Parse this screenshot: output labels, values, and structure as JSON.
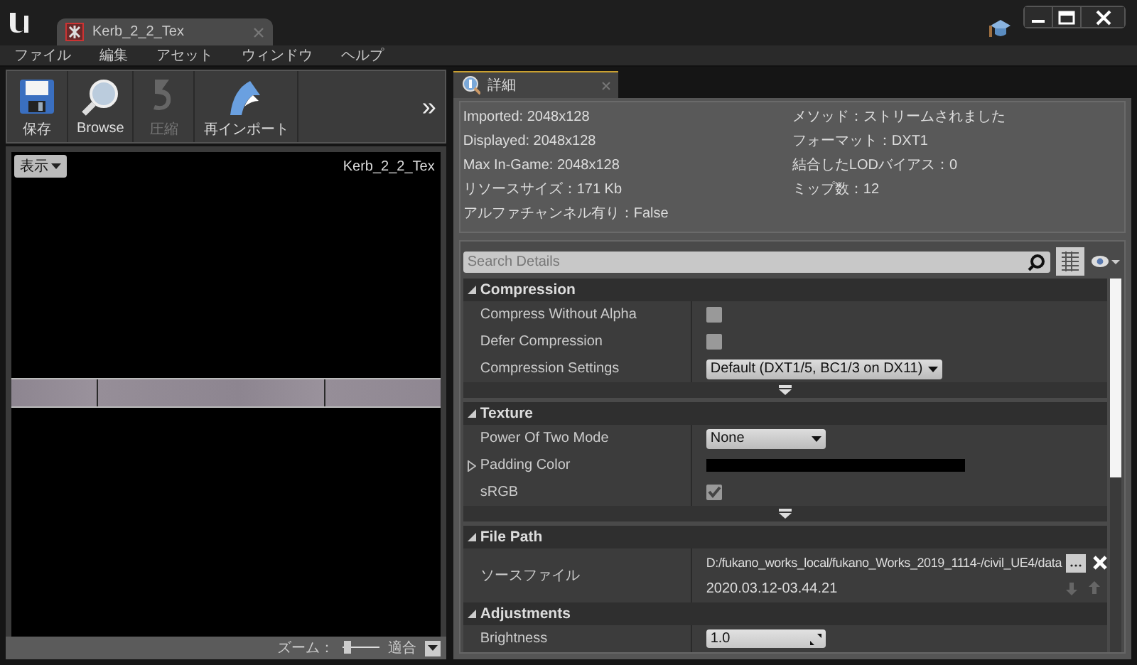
{
  "title_bar": {
    "tab": {
      "label": "Kerb_2_2_Tex",
      "selected": true
    }
  },
  "menu": [
    "ファイル",
    "編集",
    "アセット",
    "ウィンドウ",
    "ヘルプ"
  ],
  "toolbar": {
    "buttons": [
      {
        "label": "保存",
        "kind": "save",
        "disabled": false
      },
      {
        "label": "Browse",
        "kind": "browse",
        "disabled": false
      },
      {
        "label": "圧縮",
        "kind": "compress",
        "disabled": true
      },
      {
        "label": "再インポート",
        "kind": "reimport",
        "disabled": false
      }
    ],
    "overflow": "»"
  },
  "viewport": {
    "view_button": "表示",
    "asset_name": "Kerb_2_2_Tex",
    "zoom_label": "ズーム：",
    "zoom": {
      "level": 0.15
    },
    "zoom_mode": "適合"
  },
  "details": {
    "tab": {
      "label": "詳細",
      "selected": true
    },
    "info": {
      "left": [
        "Imported: 2048x128",
        "Displayed: 2048x128",
        "Max In-Game: 2048x128",
        "リソースサイズ：171 Kb",
        "アルファチャンネル有り：False"
      ],
      "right": [
        "メソッド：ストリームされました",
        "フォーマット：DXT1",
        "結合したLODバイアス：0",
        "ミップ数：12"
      ]
    },
    "search": {
      "placeholder": "Search Details"
    },
    "categories": [
      {
        "title": "Compression",
        "expanded": true,
        "advanced": true,
        "rows": [
          {
            "kind": "checkbox",
            "label": "Compress Without Alpha",
            "checked": false
          },
          {
            "kind": "checkbox",
            "label": "Defer Compression",
            "checked": false
          },
          {
            "kind": "dropdown",
            "label": "Compression Settings",
            "value": "Default (DXT1/5, BC1/3 on DX11)"
          }
        ]
      },
      {
        "title": "Texture",
        "expanded": true,
        "advanced": true,
        "rows": [
          {
            "kind": "dropdown",
            "label": "Power Of Two Mode",
            "value": "None"
          },
          {
            "kind": "color",
            "label": "Padding Color",
            "expanded": false,
            "color": "#000000"
          },
          {
            "kind": "checkbox",
            "label": "sRGB",
            "checked": true
          }
        ]
      },
      {
        "title": "File Path",
        "expanded": true,
        "rows": [
          {
            "kind": "path",
            "label": "ソースファイル",
            "value": "D:/fukano_works_local/fukano_Works_2019_1114-/civil_UE4/data",
            "timestamp": "2020.03.12-03.44.21"
          }
        ]
      },
      {
        "title": "Adjustments",
        "expanded": true,
        "rows": [
          {
            "kind": "number",
            "label": "Brightness",
            "value": "1.0"
          }
        ]
      }
    ]
  }
}
